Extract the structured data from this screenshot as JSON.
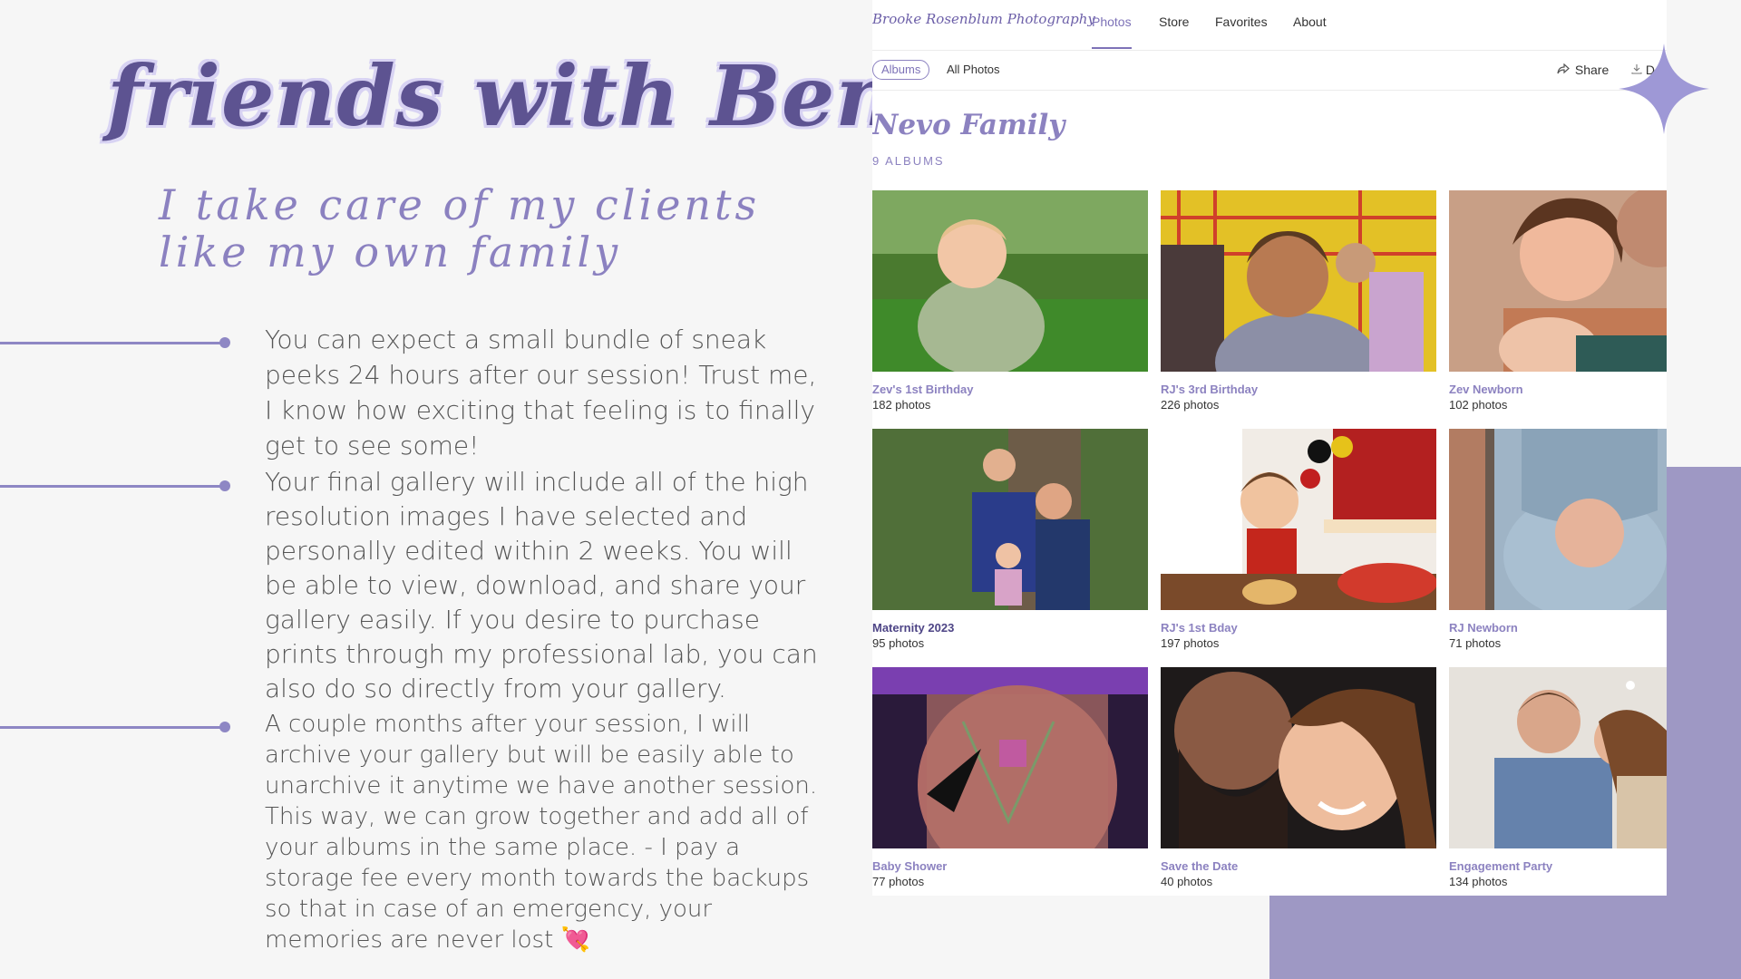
{
  "headline": "friends with Benefits",
  "tagline": [
    "I take care of my clients",
    "like my own family"
  ],
  "bullets": [
    "You can expect a small bundle of sneak peeks 24 hours after our session! Trust me, I know how exciting that feeling is to finally get to see some!",
    "Your final gallery will include all of the high resolution images I have selected and personally edited within 2 weeks. You will be able to view, download, and share your gallery easily. If you desire to purchase prints through my professional lab, you can also do so directly from your gallery.",
    "A couple months after your session, I will archive your gallery but will be easily able to unarchive it anytime we have another session. This way, we can grow together and add all of your albums in the same place.    - I pay a storage fee every month towards the backups so that in case of an emergency, your memories are never lost"
  ],
  "heart_icon": "💘",
  "gallery": {
    "brand": "Brooke Rosenblum Photography",
    "nav": [
      "Photos",
      "Store",
      "Favorites",
      "About"
    ],
    "active_nav": "Photos",
    "tabs": {
      "albums": "Albums",
      "all": "All Photos"
    },
    "share": "Share",
    "download": "D",
    "family_title": "Nevo Family",
    "album_count": "9 ALBUMS",
    "albums": [
      {
        "title": "Zev's 1st Birthday",
        "count": "182 photos"
      },
      {
        "title": "RJ's 3rd Birthday",
        "count": "226 photos"
      },
      {
        "title": "Zev Newborn",
        "count": "102 photos"
      },
      {
        "title": "Maternity 2023",
        "count": "95 photos"
      },
      {
        "title": "RJ's 1st Bday",
        "count": "197 photos"
      },
      {
        "title": "RJ Newborn",
        "count": "71 photos"
      },
      {
        "title": "Baby Shower",
        "count": "77 photos"
      },
      {
        "title": "Save the Date",
        "count": "40 photos"
      },
      {
        "title": "Engagement Party",
        "count": "134 photos"
      }
    ]
  },
  "colors": {
    "accent": "#8c82c0",
    "headline": "#5d5391",
    "block": "#9e98c4"
  }
}
